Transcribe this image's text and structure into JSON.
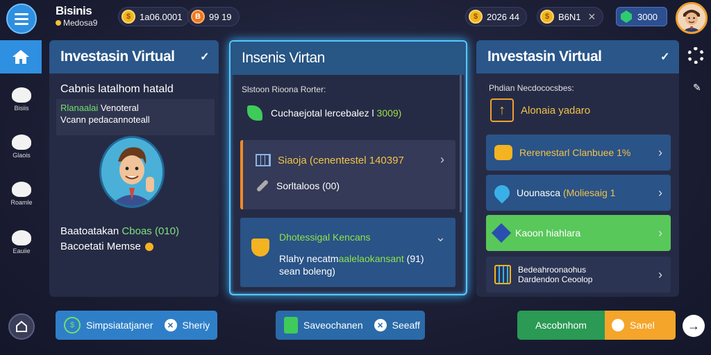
{
  "header": {
    "brand_name": "Bisinis",
    "brand_sub": "Medosa9",
    "stat1": "1a06.0001",
    "stat2": "99 19",
    "stat3": "2026 44",
    "stat4": "B6N1",
    "gems": "3000"
  },
  "nav": {
    "items": [
      "Bisiis",
      "Glaois",
      "Roamle",
      "Eauiie"
    ]
  },
  "left_panel": {
    "title": "Investasin Virtual",
    "subtitle": "Cabnis latalhom hatald",
    "box_line1_green": "Rlanaalai",
    "box_line1_rest": "Venoteral",
    "box_line2": "Vcann pedacannoteall",
    "line1_text": "Baatoatakan",
    "line1_green": "Cboas (010)",
    "line2": "Bacoetati Memse"
  },
  "center_panel": {
    "title": "Insenis Virtan",
    "label": "Slstoon Rioona Rorter:",
    "row_text": "Cuchaejotal lercebalez l",
    "row_value": "3009)",
    "card1_line1": "Siaoja (cenentestel 140397",
    "card1_line2": "Sorltaloos (00)",
    "card2_title": "Dhotessigal Kencans",
    "card2_line1_a": "Rlahy necatm",
    "card2_line1_g": "aalelaokansant",
    "card2_line1_b": "(91)",
    "card2_line2": "sean boleng)"
  },
  "right_panel": {
    "title": "Investasin Virtual",
    "label": "Phdian Necdococsbes:",
    "top_item": "Alonaia yadaro",
    "row1_a": "Rerenestarl",
    "row1_b": "Clanbuee",
    "row1_c": "1%",
    "row2_a": "Uounasca",
    "row2_b": "(Moliesaig 1",
    "row3": "Kaoon hiahlara",
    "row4_line1": "Bedeahroonaohus",
    "row4_line2": "Dardendon Ceoolop"
  },
  "bottom": {
    "left_label": "Simpsiatatjaner",
    "left_action": "Sheriy",
    "mid_label": "Saveochanen",
    "mid_action": "Seeaff",
    "right_green": "Ascobnhom",
    "right_orange": "Sanel"
  },
  "colors": {
    "accent_blue": "#2f8fe0",
    "panel_head": "#2a5689",
    "green": "#58c85a",
    "orange": "#f4a52a",
    "gold": "#f2c24a"
  }
}
